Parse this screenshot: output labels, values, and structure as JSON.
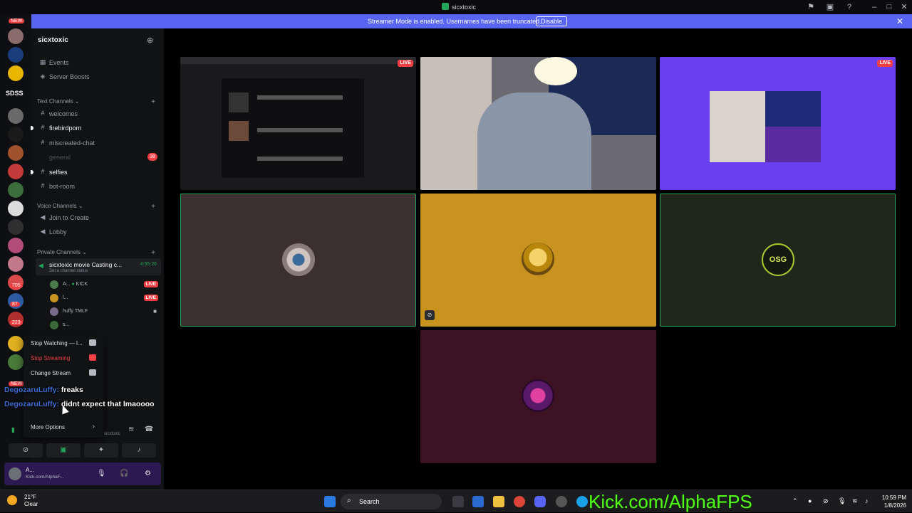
{
  "window": {
    "title": "sicxtoxic"
  },
  "banner": {
    "message": "Streamer Mode is enabled. Usernames have been truncated.",
    "disable_label": "Disable"
  },
  "guilds": {
    "new_badge_top": "NEW",
    "sdss_label": "SDSS",
    "badge_705": "705",
    "badge_87": "87",
    "badge_223": "223",
    "new_badge_bottom": "NEW"
  },
  "server": {
    "name": "sicxtoxic",
    "events_label": "Events",
    "boosts_label": "Server Boosts",
    "text_category": "Text Channels",
    "text_channels": [
      "welcomes",
      "firebirdporn",
      "miscreated-chat",
      "general",
      "selfies",
      "bot-room"
    ],
    "general_mentions": "38",
    "voice_category": "Voice Channels",
    "voice_channels": [
      "Join to Create",
      "Lobby"
    ],
    "private_category": "Private Channels",
    "active_voice": {
      "name": "sicxtoxic movie Casting c...",
      "status": "Set a channel status",
      "timer": "4:55:26"
    },
    "voice_users": [
      {
        "name": "A...",
        "tag": "KICK",
        "live": "LIVE"
      },
      {
        "name": "l...",
        "tag": "",
        "live": "LIVE"
      },
      {
        "name": "huffy",
        "tag": "TMLF",
        "live": ""
      },
      {
        "name": "s...",
        "tag": "",
        "live": ""
      }
    ]
  },
  "context_menu": {
    "items": [
      "Stop Watching — l...",
      "Stop Streaming",
      "Change Stream",
      "More Options"
    ]
  },
  "chat_overlay": [
    {
      "who": "DegozaruLuffy:",
      "what": "freaks"
    },
    {
      "who": "DegozaruLuffy:",
      "what": "didnt expect that lmaoooo"
    }
  ],
  "voice_bar": {
    "channel_hint": "sicxtoxic"
  },
  "user_panel": {
    "name": "A...",
    "status": "Kick.com/AlphaF..."
  },
  "stage": {
    "live_label": "LIVE",
    "tile_colors": [
      "#3c2f2f",
      "#c9931f",
      "#1f261a",
      "#3d1223"
    ],
    "osg_text": "OSG"
  },
  "taskbar": {
    "temperature": "21°F",
    "condition": "Clear",
    "search_label": "Search",
    "kick_text": "Kick.com/AlphaFPS",
    "time": "10:59 PM",
    "date": "1/8/2026"
  }
}
